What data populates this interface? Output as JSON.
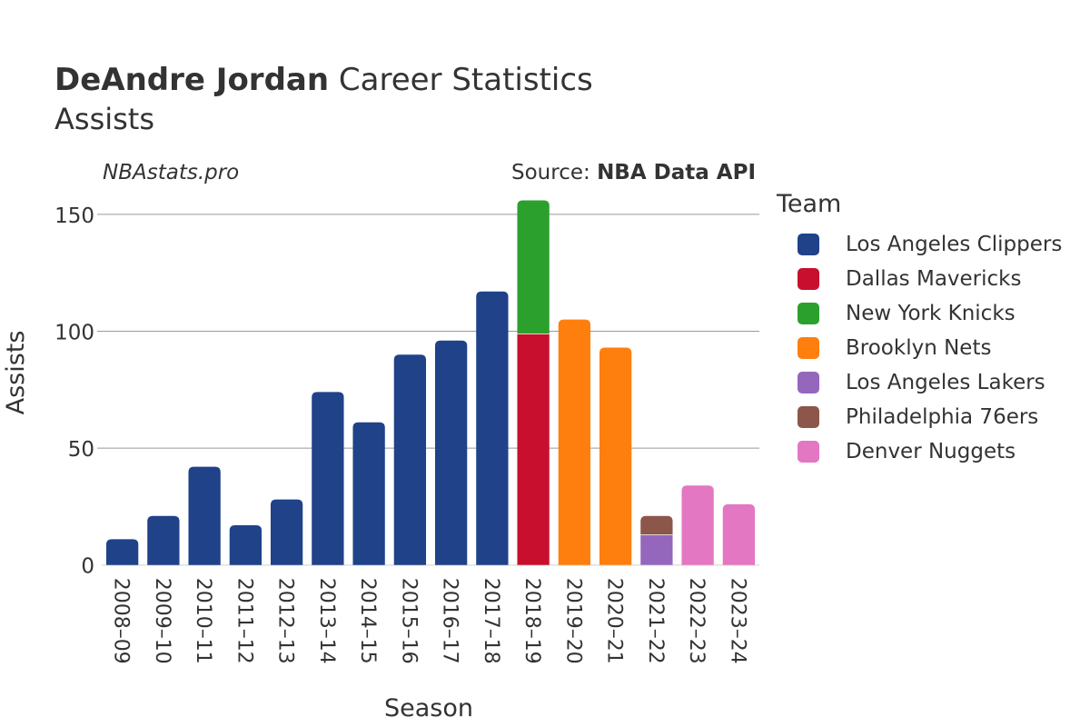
{
  "header": {
    "title_bold": "DeAndre Jordan",
    "title_rest": " Career Statistics",
    "subtitle": "Assists",
    "brand": "NBAstats.pro",
    "source_prefix": "Source: ",
    "source_name": "NBA Data API"
  },
  "chart_data": {
    "type": "bar",
    "stacked": true,
    "title": "DeAndre Jordan Career Statistics",
    "subtitle": "Assists",
    "xlabel": "Season",
    "ylabel": "Assists",
    "ylim": [
      0,
      160
    ],
    "yticks": [
      0,
      50,
      100,
      150
    ],
    "grid": true,
    "legend_title": "Team",
    "legend_position": "right",
    "categories": [
      "2008–09",
      "2009–10",
      "2010–11",
      "2011–12",
      "2012–13",
      "2013–14",
      "2014–15",
      "2015–16",
      "2016–17",
      "2017–18",
      "2018–19",
      "2019–20",
      "2020–21",
      "2021–22",
      "2022–23",
      "2023–24"
    ],
    "series": [
      {
        "name": "Los Angeles Clippers",
        "color": "#1f4289",
        "values": [
          11,
          21,
          42,
          17,
          28,
          74,
          61,
          90,
          96,
          117,
          0,
          0,
          0,
          0,
          0,
          0
        ]
      },
      {
        "name": "Dallas Mavericks",
        "color": "#c8102e",
        "values": [
          0,
          0,
          0,
          0,
          0,
          0,
          0,
          0,
          0,
          0,
          99,
          0,
          0,
          0,
          0,
          0
        ]
      },
      {
        "name": "New York Knicks",
        "color": "#2ca02c",
        "values": [
          0,
          0,
          0,
          0,
          0,
          0,
          0,
          0,
          0,
          0,
          57,
          0,
          0,
          0,
          0,
          0
        ]
      },
      {
        "name": "Brooklyn Nets",
        "color": "#ff7f0e",
        "values": [
          0,
          0,
          0,
          0,
          0,
          0,
          0,
          0,
          0,
          0,
          0,
          105,
          93,
          0,
          0,
          0
        ]
      },
      {
        "name": "Los Angeles Lakers",
        "color": "#9467bd",
        "values": [
          0,
          0,
          0,
          0,
          0,
          0,
          0,
          0,
          0,
          0,
          0,
          0,
          0,
          13,
          0,
          0
        ]
      },
      {
        "name": "Philadelphia 76ers",
        "color": "#8c564b",
        "values": [
          0,
          0,
          0,
          0,
          0,
          0,
          0,
          0,
          0,
          0,
          0,
          0,
          0,
          8,
          0,
          0
        ]
      },
      {
        "name": "Denver Nuggets",
        "color": "#e377c2",
        "values": [
          0,
          0,
          0,
          0,
          0,
          0,
          0,
          0,
          0,
          0,
          0,
          0,
          0,
          0,
          34,
          26
        ]
      }
    ]
  }
}
